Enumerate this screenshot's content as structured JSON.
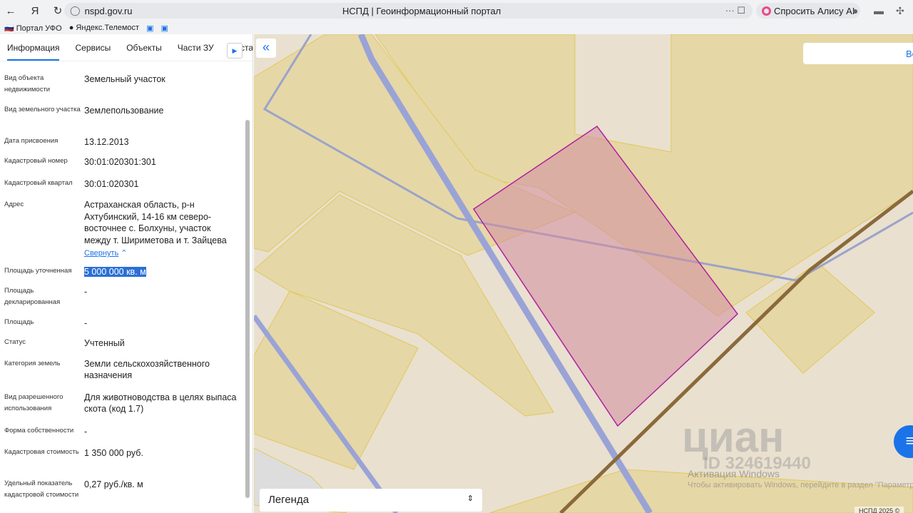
{
  "browser": {
    "url": "nspd.gov.ru",
    "title": "НСПД | Геоинформационный портал",
    "alice": "Спросить Алису AI",
    "bookmarks": [
      "Портал УФО",
      "Яндекс.Телемост"
    ]
  },
  "tabs": [
    "Информация",
    "Сервисы",
    "Объекты",
    "Части ЗУ",
    "Соста"
  ],
  "fields": [
    {
      "label": "Вид объекта недвижимости",
      "value": "Земельный участок"
    },
    {
      "label": "Вид земельного участка",
      "value": "Землепользование"
    },
    {
      "label": "Дата присвоения",
      "value": "13.12.2013"
    },
    {
      "label": "Кадастровый номер",
      "value": "30:01:020301:301"
    },
    {
      "label": "Кадастровый квартал",
      "value": "30:01:020301"
    },
    {
      "label": "Адрес",
      "value": "Астраханская область, р-н Ахтубинский, 14-16 км северо-восточнее с. Болхуны, участок между т. Шириметова и т. Зайцева"
    },
    {
      "label": "Площадь уточненная",
      "value": "5 000 000 кв. м"
    },
    {
      "label": "Площадь декларированная",
      "value": "-"
    },
    {
      "label": "Площадь",
      "value": "-"
    },
    {
      "label": "Статус",
      "value": "Учтенный"
    },
    {
      "label": "Категория земель",
      "value": "Земли сельскохозяйственного назначения"
    },
    {
      "label": "Вид разрешенного использования",
      "value": "Для животноводства в целях выпаса скота (код 1.7)"
    },
    {
      "label": "Форма собственности",
      "value": "-"
    },
    {
      "label": "Кадастровая стоимость",
      "value": "1 350 000 руб."
    },
    {
      "label": "Удельный показатель кадастровой стоимости",
      "value": "0,27 руб./кв. м"
    }
  ],
  "collapse_link": "Свернуть",
  "map": {
    "search_label": "Вс",
    "legend": "Легенда",
    "copyright": "НСПД 2025 ©",
    "watermark": "циан",
    "watermark_id": "ID 324619440",
    "activation_title": "Активация Windows",
    "activation_text": "Чтобы активировать Windows, перейдите в раздел \"Параметры\""
  }
}
